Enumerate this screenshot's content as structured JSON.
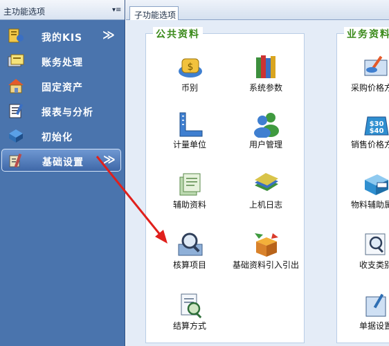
{
  "left": {
    "title": "主功能选项",
    "pin_glyph": "▾≡",
    "items": [
      {
        "label": "我的KIS",
        "icon": "kis-icon",
        "chevron": "≫"
      },
      {
        "label": "账务处理",
        "icon": "ledger-icon"
      },
      {
        "label": "固定资产",
        "icon": "house-icon"
      },
      {
        "label": "报表与分析",
        "icon": "report-icon"
      },
      {
        "label": "初始化",
        "icon": "init-icon"
      },
      {
        "label": "基础设置",
        "icon": "settings-icon",
        "chevron": "≫"
      }
    ]
  },
  "right": {
    "tab": "子功能选项",
    "groups": [
      {
        "title": "公共资料",
        "tiles": [
          {
            "label": "币别",
            "icon": "currency-icon"
          },
          {
            "label": "系统参数",
            "icon": "books-icon"
          },
          {
            "label": "计量单位",
            "icon": "ruler-icon"
          },
          {
            "label": "用户管理",
            "icon": "users-icon"
          },
          {
            "label": "辅助资料",
            "icon": "papers-icon"
          },
          {
            "label": "上机日志",
            "icon": "log-icon"
          },
          {
            "label": "核算项目",
            "icon": "magnifier-icon"
          },
          {
            "label": "基础资料引入引出",
            "icon": "box-arrows-icon"
          },
          {
            "label": "结算方式",
            "icon": "settle-icon"
          }
        ]
      },
      {
        "title": "业务资料",
        "tiles": [
          {
            "label": "采购价格方案",
            "icon": "purchase-icon"
          },
          {
            "label": "销售价格方案",
            "icon": "price-tag-icon"
          },
          {
            "label": "物料辅助属性",
            "icon": "material-icon"
          },
          {
            "label": "收支类别",
            "icon": "category-icon"
          },
          {
            "label": "单据设置",
            "icon": "doc-setting-icon"
          }
        ]
      }
    ]
  },
  "colors": {
    "accent": "#4a74ad",
    "group_title": "#3a8a1a",
    "arrow": "#e0201c"
  }
}
